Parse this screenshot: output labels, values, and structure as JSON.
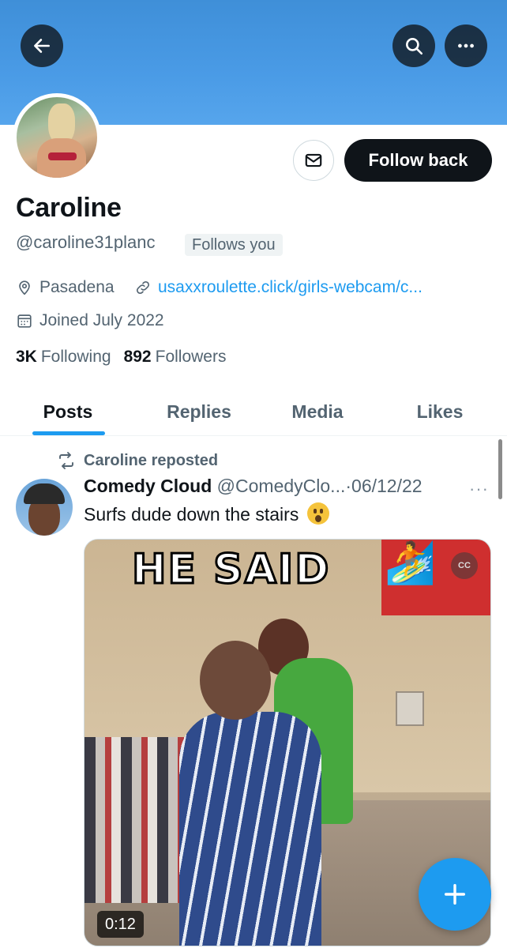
{
  "header": {
    "back_icon": "arrow-left-icon",
    "search_icon": "search-icon",
    "more_icon": "more-horizontal-icon"
  },
  "profile": {
    "name": "Caroline",
    "handle": "@caroline31planc",
    "follows_you_badge": "Follows you",
    "follow_button": "Follow back",
    "message_icon": "mail-icon",
    "location": "Pasadena",
    "website": "usaxxroulette.click/girls-webcam/c...",
    "joined": "Joined July 2022",
    "following_count": "3K",
    "following_label": "Following",
    "followers_count": "892",
    "followers_label": "Followers"
  },
  "tabs": [
    {
      "label": "Posts",
      "active": true
    },
    {
      "label": "Replies",
      "active": false
    },
    {
      "label": "Media",
      "active": false
    },
    {
      "label": "Likes",
      "active": false
    }
  ],
  "post": {
    "repost_label": "Caroline reposted",
    "author": "Comedy Cloud",
    "author_handle": "@ComedyClo...",
    "separator": "·",
    "date": "06/12/22",
    "more": "···",
    "text": "Surfs dude down the stairs",
    "media": {
      "caption": "HE SAID",
      "cc_label": "CC",
      "duration": "0:12"
    }
  },
  "fab": {
    "icon": "plus-icon"
  },
  "colors": {
    "accent": "#1d9bf0",
    "banner": "#4a9be6",
    "text_primary": "#0f1419",
    "text_muted": "#536471"
  }
}
